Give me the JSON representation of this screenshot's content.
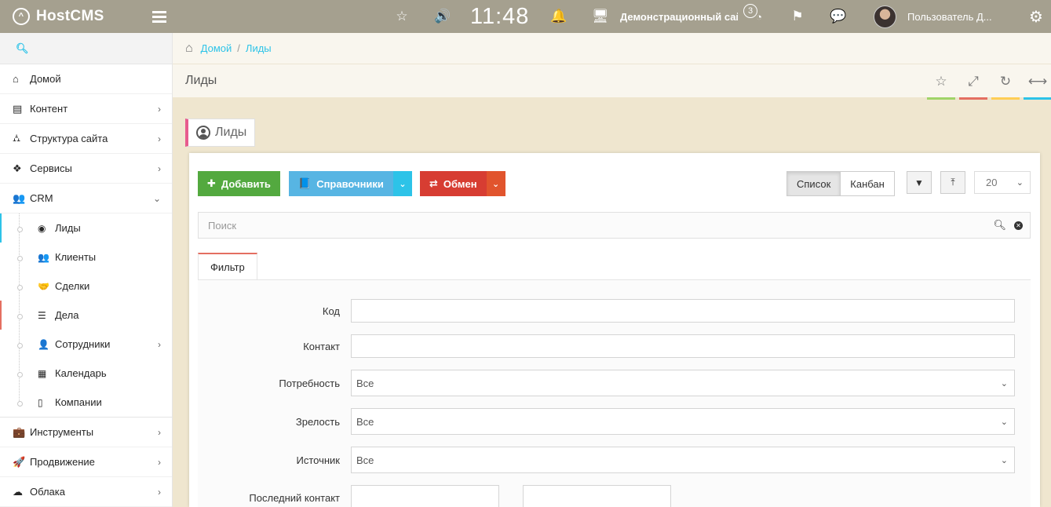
{
  "topbar": {
    "logo": "HostCMS",
    "time": "11:48",
    "site_name": "Демонстрационный сайт",
    "notification_count": "3",
    "user_name": "Пользователь Д..."
  },
  "sidebar": {
    "items": [
      {
        "label": "Домой"
      },
      {
        "label": "Контент"
      },
      {
        "label": "Структура сайта"
      },
      {
        "label": "Сервисы"
      },
      {
        "label": "CRM"
      }
    ],
    "crm_items": [
      {
        "label": "Лиды"
      },
      {
        "label": "Клиенты"
      },
      {
        "label": "Сделки"
      },
      {
        "label": "Дела"
      },
      {
        "label": "Сотрудники"
      },
      {
        "label": "Календарь"
      },
      {
        "label": "Компании"
      }
    ],
    "bottom_items": [
      {
        "label": "Инструменты"
      },
      {
        "label": "Продвижение"
      },
      {
        "label": "Облака"
      }
    ]
  },
  "breadcrumbs": [
    "Домой",
    "Лиды"
  ],
  "page": {
    "title": "Лиды",
    "tab_label": "Лиды",
    "accent_colors": [
      "#a0d468",
      "#e46f61",
      "#ffce55",
      "#2dc3e8"
    ]
  },
  "toolbar": {
    "add_label": "Добавить",
    "directories_label": "Справочники",
    "exchange_label": "Обмен",
    "view_list": "Список",
    "view_kanban": "Канбан",
    "per_page": "20"
  },
  "search": {
    "placeholder": "Поиск"
  },
  "filter": {
    "tab": "Фильтр",
    "fields": [
      {
        "label": "Код",
        "value": ""
      },
      {
        "label": "Контакт",
        "value": ""
      },
      {
        "label": "Потребность",
        "value": "Все"
      },
      {
        "label": "Зрелость",
        "value": "Все"
      },
      {
        "label": "Источник",
        "value": "Все"
      },
      {
        "label": "Последний контакт",
        "value": ""
      }
    ]
  }
}
